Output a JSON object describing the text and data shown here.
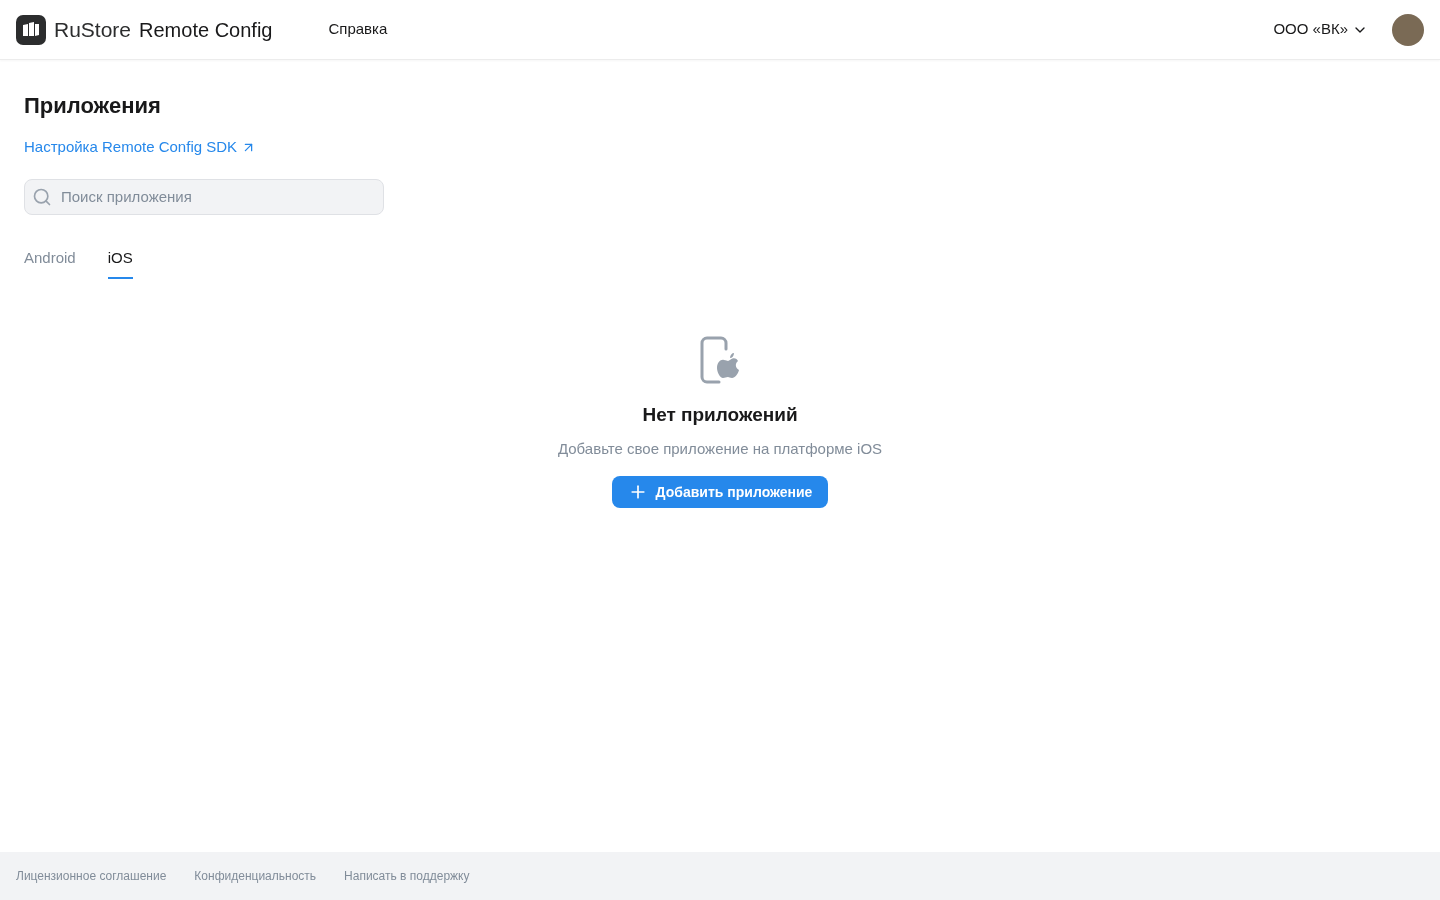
{
  "header": {
    "brand": "RuStore",
    "product": "Remote Config",
    "nav": [
      "Справка"
    ],
    "org": "ООО «ВК»"
  },
  "page": {
    "title": "Приложения",
    "sdk_link": "Настройка Remote Config SDK",
    "search": {
      "placeholder": "Поиск приложения"
    },
    "tabs": [
      {
        "label": "Android",
        "selected": false
      },
      {
        "label": "iOS",
        "selected": true
      }
    ],
    "empty": {
      "title": "Нет приложений",
      "text": "Добавьте свое приложение на платформе iOS",
      "button": "Добавить приложение"
    }
  },
  "footer": {
    "links": [
      "Лицензионное соглашение",
      "Конфиденциальность",
      "Написать в поддержку"
    ]
  }
}
